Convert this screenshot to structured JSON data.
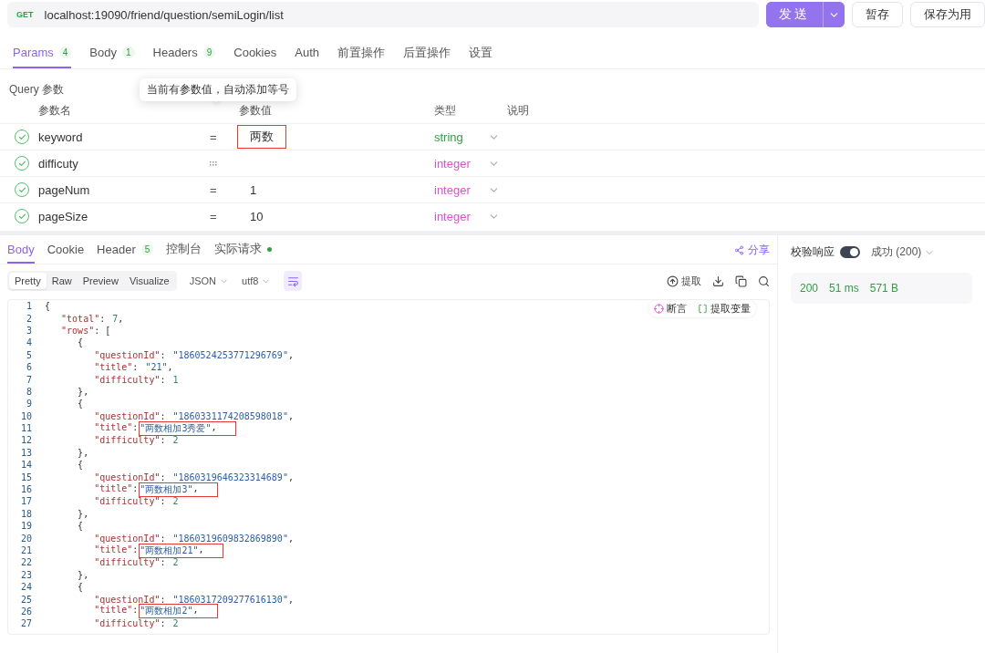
{
  "request_bar": {
    "method": "GET",
    "url": "localhost:19090/friend/question/semiLogin/list",
    "send": "发送",
    "save_draft": "暂存",
    "save_case": "保存为用"
  },
  "request_tabs": [
    {
      "label": "Params",
      "count": "4",
      "selected": true
    },
    {
      "label": "Body",
      "count": "1",
      "selected": false
    },
    {
      "label": "Headers",
      "count": "9",
      "selected": false
    },
    {
      "label": "Cookies",
      "selected": false
    },
    {
      "label": "Auth",
      "selected": false
    },
    {
      "label": "前置操作",
      "selected": false
    },
    {
      "label": "后置操作",
      "selected": false
    },
    {
      "label": "设置",
      "selected": false
    }
  ],
  "query": {
    "title": "Query 参数",
    "tooltip": "当前有参数值，自动添加等号",
    "columns": [
      "参数名",
      "参数值",
      "类型",
      "说明"
    ],
    "rows": [
      {
        "kind": "filled",
        "enabled": true,
        "name": "keyword",
        "separator": "=",
        "value": "两数",
        "marked": true,
        "type": "string",
        "color": "#2ea043"
      },
      {
        "kind": "empty",
        "enabled": true,
        "name": "difficuty",
        "type": "integer",
        "color": "#e04fd0"
      },
      {
        "kind": "filled",
        "enabled": true,
        "name": "pageNum",
        "separator": "=",
        "value": "1",
        "marked": false,
        "type": "integer",
        "color": "#e04fd0"
      },
      {
        "kind": "filled",
        "enabled": true,
        "name": "pageSize",
        "separator": "=",
        "value": "10",
        "marked": false,
        "type": "integer",
        "color": "#e04fd0"
      }
    ]
  },
  "response_tabs": [
    {
      "label": "Body",
      "selected": true
    },
    {
      "label": "Cookie",
      "selected": false
    },
    {
      "label": "Header",
      "count": "5",
      "selected": false
    },
    {
      "label": "控制台",
      "selected": false
    },
    {
      "label": "实际请求",
      "dot": true,
      "selected": false
    }
  ],
  "share": "分享",
  "view_modes": [
    {
      "label": "Pretty",
      "selected": true
    },
    {
      "label": "Raw",
      "selected": false
    },
    {
      "label": "Preview",
      "selected": false
    },
    {
      "label": "Visualize",
      "selected": false
    }
  ],
  "format_selects": [
    "JSON",
    "utf8"
  ],
  "extract": "提取",
  "floating_actions": {
    "assert": "断言",
    "extract_variable": "提取变量"
  },
  "validation": {
    "label": "校验响应",
    "on": true,
    "status": "成功 (200)"
  },
  "stats": [
    "200",
    "51 ms",
    "571 B"
  ],
  "code_lines": [
    {
      "no": "1",
      "parts": [
        {
          "kind": "punct",
          "text": "{"
        }
      ]
    },
    {
      "no": "2",
      "marked": false,
      "parts": [
        {
          "kind": "key",
          "text": "   \"total\""
        },
        {
          "kind": "punct",
          "text": ": "
        },
        {
          "kind": "number",
          "text": "7"
        },
        {
          "kind": "punct",
          "text": ","
        }
      ]
    },
    {
      "no": "3",
      "parts": [
        {
          "kind": "key",
          "text": "   \"rows\""
        },
        {
          "kind": "punct",
          "text": ": ["
        }
      ]
    },
    {
      "no": "4",
      "parts": [
        {
          "kind": "punct",
          "text": "      {"
        }
      ]
    },
    {
      "no": "5",
      "marked": false,
      "parts": [
        {
          "kind": "key",
          "text": "         \"questionId\""
        },
        {
          "kind": "punct",
          "text": ": "
        },
        {
          "kind": "string",
          "text": "\"1860524253771296769\""
        },
        {
          "kind": "punct",
          "text": ","
        }
      ]
    },
    {
      "no": "6",
      "marked": false,
      "parts": [
        {
          "kind": "key",
          "text": "         \"title\""
        },
        {
          "kind": "punct",
          "text": ": "
        },
        {
          "kind": "string",
          "text": "\"21\""
        },
        {
          "kind": "punct",
          "text": ","
        }
      ]
    },
    {
      "no": "7",
      "marked": false,
      "parts": [
        {
          "kind": "key",
          "text": "         \"difficulty\""
        },
        {
          "kind": "punct",
          "text": ": "
        },
        {
          "kind": "number",
          "text": "1"
        }
      ]
    },
    {
      "no": "8",
      "parts": [
        {
          "kind": "punct",
          "text": "      },"
        }
      ]
    },
    {
      "no": "9",
      "parts": [
        {
          "kind": "punct",
          "text": "      {"
        }
      ]
    },
    {
      "no": "10",
      "marked": false,
      "parts": [
        {
          "kind": "key",
          "text": "         \"questionId\""
        },
        {
          "kind": "punct",
          "text": ": "
        },
        {
          "kind": "string",
          "text": "\"1860331174208598018\""
        },
        {
          "kind": "punct",
          "text": ","
        }
      ]
    },
    {
      "no": "11",
      "marked": true,
      "parts": [
        {
          "kind": "key",
          "text": "         \"title\""
        },
        {
          "kind": "punct",
          "text": ":"
        },
        {
          "kind": "string",
          "text": "\"两数相加3秀爱\""
        },
        {
          "kind": "punct",
          "text": ","
        }
      ]
    },
    {
      "no": "12",
      "marked": false,
      "parts": [
        {
          "kind": "key",
          "text": "         \"difficulty\""
        },
        {
          "kind": "punct",
          "text": ": "
        },
        {
          "kind": "number",
          "text": "2"
        }
      ]
    },
    {
      "no": "13",
      "parts": [
        {
          "kind": "punct",
          "text": "      },"
        }
      ]
    },
    {
      "no": "14",
      "parts": [
        {
          "kind": "punct",
          "text": "      {"
        }
      ]
    },
    {
      "no": "15",
      "marked": false,
      "parts": [
        {
          "kind": "key",
          "text": "         \"questionId\""
        },
        {
          "kind": "punct",
          "text": ": "
        },
        {
          "kind": "string",
          "text": "\"1860319646323314689\""
        },
        {
          "kind": "punct",
          "text": ","
        }
      ]
    },
    {
      "no": "16",
      "marked": true,
      "parts": [
        {
          "kind": "key",
          "text": "         \"title\""
        },
        {
          "kind": "punct",
          "text": ":"
        },
        {
          "kind": "string",
          "text": "\"两数相加3\""
        },
        {
          "kind": "punct",
          "text": ","
        }
      ]
    },
    {
      "no": "17",
      "marked": false,
      "parts": [
        {
          "kind": "key",
          "text": "         \"difficulty\""
        },
        {
          "kind": "punct",
          "text": ": "
        },
        {
          "kind": "number",
          "text": "2"
        }
      ]
    },
    {
      "no": "18",
      "parts": [
        {
          "kind": "punct",
          "text": "      },"
        }
      ]
    },
    {
      "no": "19",
      "parts": [
        {
          "kind": "punct",
          "text": "      {"
        }
      ]
    },
    {
      "no": "20",
      "marked": false,
      "parts": [
        {
          "kind": "key",
          "text": "         \"questionId\""
        },
        {
          "kind": "punct",
          "text": ": "
        },
        {
          "kind": "string",
          "text": "\"1860319609832869890\""
        },
        {
          "kind": "punct",
          "text": ","
        }
      ]
    },
    {
      "no": "21",
      "marked": true,
      "parts": [
        {
          "kind": "key",
          "text": "         \"title\""
        },
        {
          "kind": "punct",
          "text": ":"
        },
        {
          "kind": "string",
          "text": "\"两数相加21\""
        },
        {
          "kind": "punct",
          "text": ","
        }
      ]
    },
    {
      "no": "22",
      "marked": false,
      "parts": [
        {
          "kind": "key",
          "text": "         \"difficulty\""
        },
        {
          "kind": "punct",
          "text": ": "
        },
        {
          "kind": "number",
          "text": "2"
        }
      ]
    },
    {
      "no": "23",
      "parts": [
        {
          "kind": "punct",
          "text": "      },"
        }
      ]
    },
    {
      "no": "24",
      "parts": [
        {
          "kind": "punct",
          "text": "      {"
        }
      ]
    },
    {
      "no": "25",
      "marked": false,
      "parts": [
        {
          "kind": "key",
          "text": "         \"questionId\""
        },
        {
          "kind": "punct",
          "text": ": "
        },
        {
          "kind": "string",
          "text": "\"1860317209277616130\""
        },
        {
          "kind": "punct",
          "text": ","
        }
      ]
    },
    {
      "no": "26",
      "marked": true,
      "parts": [
        {
          "kind": "key",
          "text": "         \"title\""
        },
        {
          "kind": "punct",
          "text": ":"
        },
        {
          "kind": "string",
          "text": "\"两数相加2\""
        },
        {
          "kind": "punct",
          "text": ","
        }
      ]
    },
    {
      "no": "27",
      "marked": false,
      "parts": [
        {
          "kind": "key",
          "text": "         \"difficulty\""
        },
        {
          "kind": "punct",
          "text": ": "
        },
        {
          "kind": "number",
          "text": "2"
        }
      ]
    }
  ]
}
